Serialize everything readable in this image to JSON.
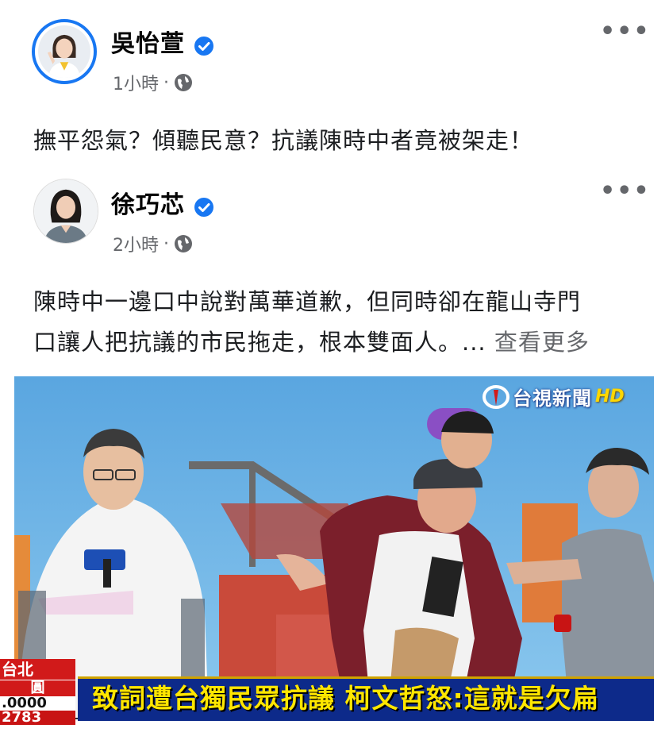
{
  "posts": [
    {
      "author": "吳怡萱",
      "time": "1小時",
      "separator": "·",
      "text": "撫平怨氣？傾聽民意？抗議陳時中者竟被架走！"
    },
    {
      "author": "徐巧芯",
      "time": "2小時",
      "separator": "·",
      "text_line1": "陳時中一邊口中說對萬華道歉，但同時卻在龍山寺門",
      "text_line2": "口讓人把抗議的市民拖走，根本雙面人。...",
      "see_more": "查看更多"
    }
  ],
  "more_icon": "•••",
  "media": {
    "channel_logo": "台視新聞",
    "channel_hd": "HD",
    "caption": "致詞遭台獨民眾抗議 柯文哲怒:這就是欠扁",
    "ticker": {
      "city": "台北",
      "unit": "圓",
      "value": ".0000",
      "change": "2783"
    }
  },
  "colors": {
    "verified": "#1877f2",
    "avatar_ring": "#1877f2",
    "caption_bg": "#0d2a8a",
    "caption_text": "#ffe600",
    "ticker_red": "#d11a1a"
  }
}
